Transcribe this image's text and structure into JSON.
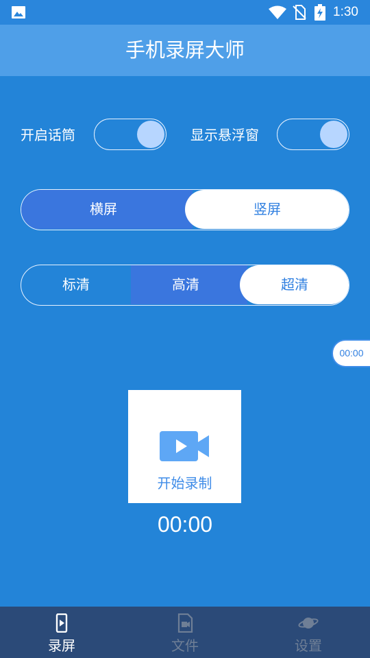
{
  "status_bar": {
    "time": "1:30",
    "icons": [
      "image-icon",
      "wifi-icon",
      "no-sim-icon",
      "battery-charging-icon"
    ]
  },
  "app_bar": {
    "title": "手机录屏大师"
  },
  "toggles": [
    {
      "label": "开启话筒",
      "on": true
    },
    {
      "label": "显示悬浮窗",
      "on": true
    }
  ],
  "orientation": {
    "options": [
      "横屏",
      "竖屏"
    ],
    "selected": "竖屏"
  },
  "quality": {
    "options": [
      "标清",
      "高清",
      "超清"
    ],
    "selected": "超清"
  },
  "floating_timer": "00:00",
  "record": {
    "label": "开始录制",
    "icon": "video-camera-icon"
  },
  "timer": "00:00",
  "bottom_nav": {
    "items": [
      {
        "label": "录屏",
        "icon": "phone-record-icon",
        "active": true
      },
      {
        "label": "文件",
        "icon": "video-file-icon",
        "active": false
      },
      {
        "label": "设置",
        "icon": "planet-icon",
        "active": false
      }
    ]
  },
  "colors": {
    "background": "#2384d8",
    "app_bar": "#4f9fe8",
    "accent": "#2f7fe0",
    "nav": "#2b4a78"
  }
}
